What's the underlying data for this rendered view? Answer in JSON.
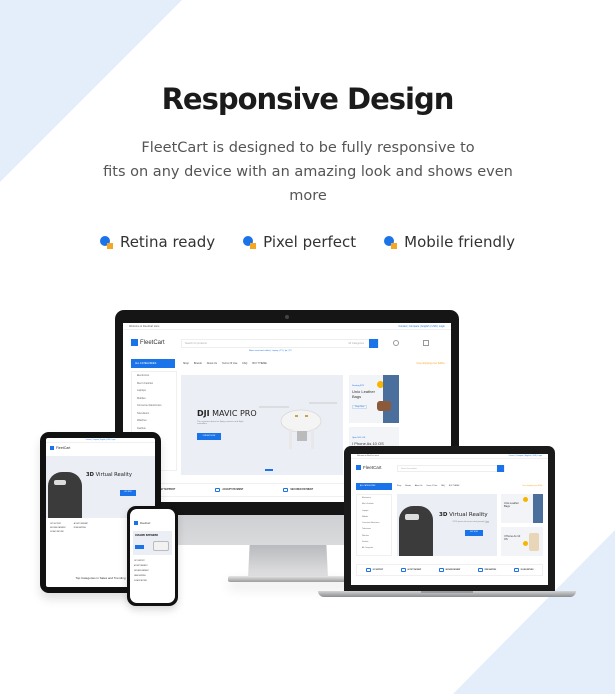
{
  "heading": "Responsive Design",
  "description": {
    "line1": "FleetCart is designed to be fully responsive to",
    "line2": "fits on any device with an amazing look and shows even",
    "line3": "more"
  },
  "features": [
    {
      "icon": "blue-circle-orange-square-bullet",
      "label": "Retina ready"
    },
    {
      "icon": "blue-circle-orange-square-bullet",
      "label": "Pixel perfect"
    },
    {
      "icon": "blue-circle-orange-square-bullet",
      "label": "Mobile friendly"
    }
  ],
  "colors": {
    "accent_blue": "#1a73e8",
    "accent_orange": "#f6a623",
    "background_shape": "#e4eefa"
  },
  "mockup_site": {
    "welcome": "Welcome to FleetCart store",
    "top_links": "Contact | Compare | English | USD | Login",
    "brand": "FleetCart",
    "search_placeholder": "Search for products",
    "search_category": "All Categories",
    "popular": "Most searched: tablet | Laptop | TV | Ipt | TV",
    "all_categories": "ALL CATEGORIES",
    "nav": [
      "Shop",
      "Brands",
      "About Us",
      "Terms Of Use",
      "FAQ",
      "BUY THEME"
    ],
    "free_shipping": "Free shipping over $100+",
    "categories": [
      "Electronics",
      "Men's Fashion",
      "Laptops",
      "Mobiles",
      "Consumer Electronics",
      "Televisions",
      "Watches",
      "Fashion",
      "All Categories"
    ],
    "desktop_hero_title_bold": "DJI",
    "desktop_hero_title": "MAVIC PRO",
    "desktop_hero_sub": "The smartest drone for flying cameras and flight controllers",
    "hero_cta": "ORDER NOW",
    "laptop_hero_title_bold": "3D",
    "laptop_hero_title": "Virtual Reality",
    "laptop_hero_sub": "VR 3D glasses with remote control gamepad & best price",
    "laptop_cta": "BUY NOW",
    "banner1_tag": "Starting $79",
    "banner1_title": "Unio Leather Bags",
    "banner1_cta": "Shop Now",
    "banner2_tag": "Upto 50% Off",
    "banner2_title": "I Phone As 10 OS",
    "banner2_cta": "Shop Now",
    "service_features": [
      "24/7 SUPPORT",
      "ACCEPT PAYMENT",
      "SECURED PAYMENT",
      "FREE SHIPPING",
      "30 DAYS RETURN"
    ],
    "tablet_section_title": "Top Categories in Sales and Trending",
    "phone_hero_title": "XIAOMI SPEAKER"
  }
}
